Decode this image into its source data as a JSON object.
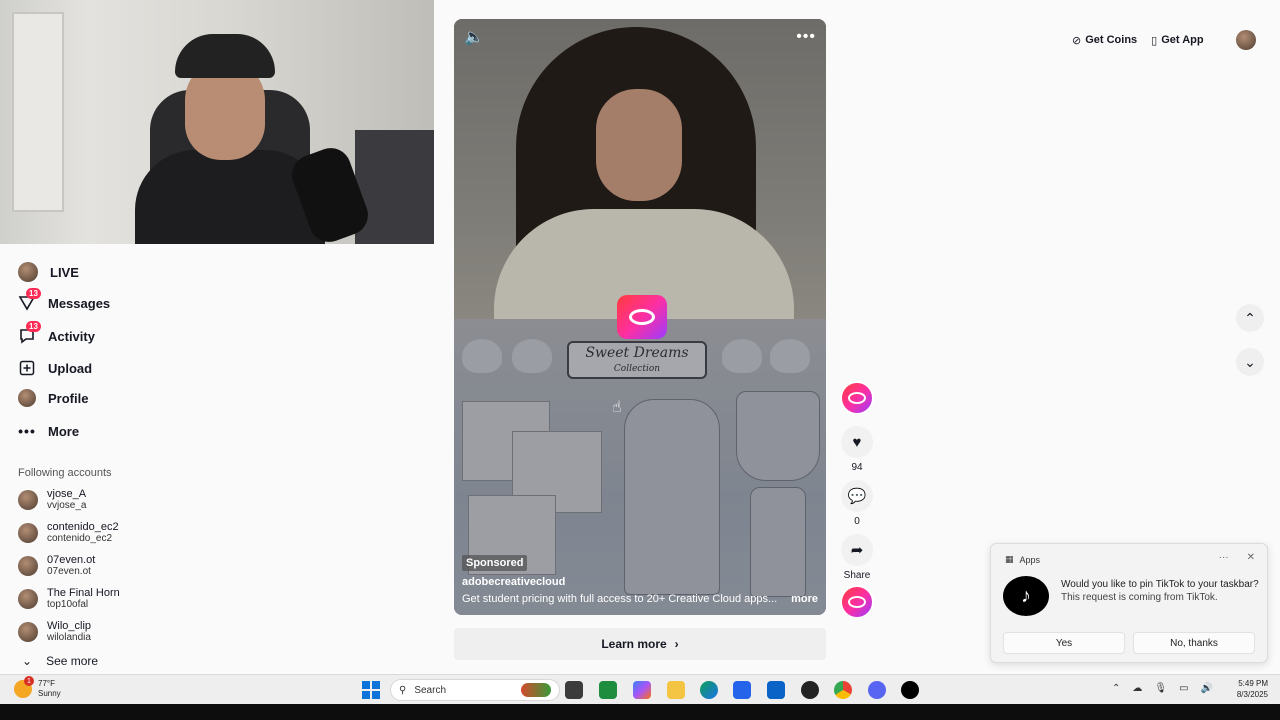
{
  "sidebar": {
    "nav": [
      {
        "label": "LIVE",
        "icon": "live-avatar-icon"
      },
      {
        "label": "Messages",
        "icon": "messages-icon",
        "badge": "13"
      },
      {
        "label": "Activity",
        "icon": "activity-icon",
        "badge": "13"
      },
      {
        "label": "Upload",
        "icon": "upload-icon"
      },
      {
        "label": "Profile",
        "icon": "profile-avatar-icon"
      },
      {
        "label": "More",
        "icon": "more-dots-icon"
      }
    ],
    "following_title": "Following accounts",
    "accounts": [
      {
        "name": "vjose_A",
        "handle": "vvjose_a"
      },
      {
        "name": "contenido_ec2",
        "handle": "contenido_ec2"
      },
      {
        "name": "07even.ot",
        "handle": "07even.ot"
      },
      {
        "name": "The Final Horn",
        "handle": "top10ofal"
      },
      {
        "name": "Wilo_clip",
        "handle": "wilolandia"
      }
    ],
    "see_more": "See more"
  },
  "video": {
    "banner_title": "Sweet Dreams",
    "banner_subtitle": "Collection",
    "sponsored": "Sponsored",
    "author": "adobecreativecloud",
    "caption": "Get student pricing with full access to 20+ Creative Cloud apps...",
    "more": "more",
    "learn_more": "Learn more"
  },
  "actions": {
    "likes": "94",
    "comments": "0",
    "share": "Share"
  },
  "header": {
    "get_coins": "Get Coins",
    "get_app": "Get App"
  },
  "toast": {
    "app_label": "Apps",
    "message": "Would you like to pin TikTok to your taskbar?",
    "sub": "This request is coming from TikTok.",
    "yes": "Yes",
    "no": "No, thanks"
  },
  "taskbar": {
    "temp": "77°F",
    "condition": "Sunny",
    "weather_badge": "1",
    "search": "Search",
    "time": "5:49 PM",
    "date": "8/3/2025"
  },
  "colors": {
    "accent": "#fe2c55",
    "adobe": "#ff2fa0",
    "windows_blue": "#0a74da"
  }
}
